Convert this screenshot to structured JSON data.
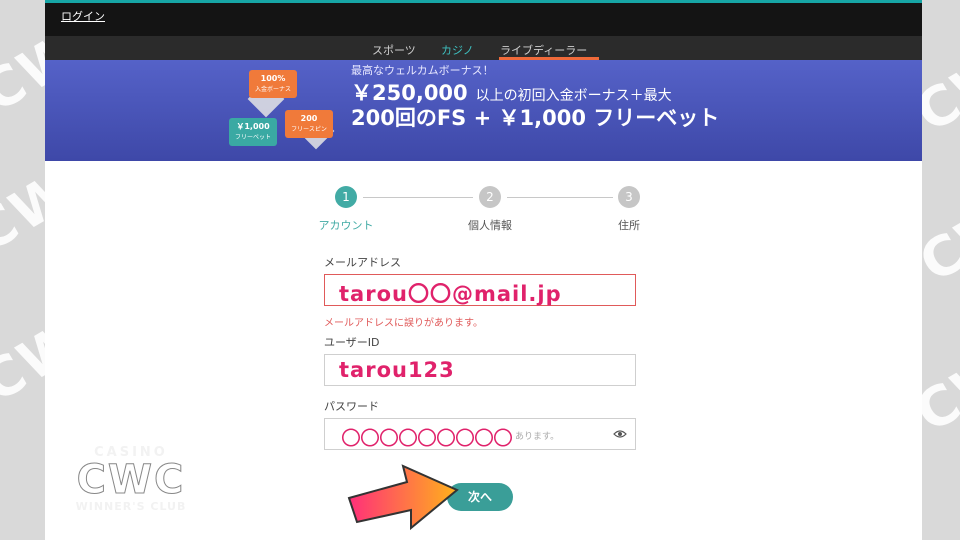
{
  "watermark": {
    "casino": "CASINO",
    "cwc": "CWC",
    "winners_club": "WINNER'S CLUB"
  },
  "topbar": {
    "login_label": "ログイン"
  },
  "nav": {
    "items": [
      {
        "label": "スポーツ"
      },
      {
        "label": "カジノ"
      },
      {
        "label": "ライブディーラー"
      }
    ]
  },
  "banner": {
    "subtitle": "最高なウェルカムボーナス！",
    "amount": "￥250,000",
    "line1_rest": "以上の初回入金ボーナス＋最大",
    "line2": "200回のFS + ￥1,000 フリーベット",
    "tags": {
      "deposit_pct": "100%",
      "deposit_label": "入金ボーナス",
      "freebet_amount": "￥1,000",
      "freebet_label": "フリーベット",
      "spins_count": "200",
      "spins_label": "フリースピン"
    }
  },
  "stepper": {
    "steps": [
      {
        "number": "1",
        "label": "アカウント"
      },
      {
        "number": "2",
        "label": "個人情報"
      },
      {
        "number": "3",
        "label": "住所"
      }
    ]
  },
  "form": {
    "email": {
      "label": "メールアドレス",
      "value": "tarou〇〇@mail.jp",
      "error": "メールアドレスに誤りがあります。"
    },
    "userid": {
      "label": "ユーザーID",
      "value": "tarou123"
    },
    "password": {
      "label": "パスワード",
      "placeholder_tail": "あります。",
      "masked": "〇〇〇〇〇〇〇〇〇"
    },
    "next_label": "次へ"
  },
  "colors": {
    "accent": "#42aba5",
    "error": "#e05a5a",
    "annotation": "#e0226b",
    "banner": "#4652b8"
  }
}
